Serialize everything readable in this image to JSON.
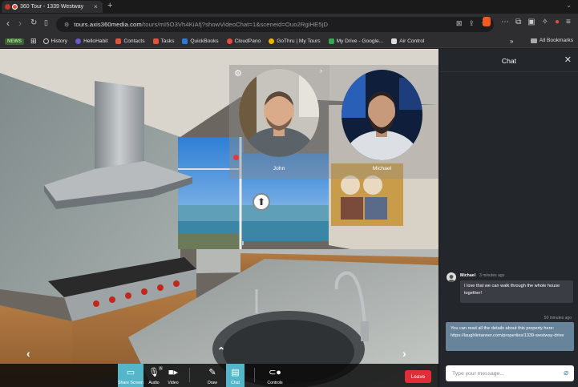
{
  "browser": {
    "tab_title": "360 Tour - 1339 Westway",
    "tab_close": "×",
    "new_tab": "+",
    "url_host": "tours.axis360media.com",
    "url_path": "/tours/mI5O3Vh4KiAfj?showVideoChat=1&sceneid=Ouo2RgiHE5jD",
    "brave_badge": "4"
  },
  "bookmarks": {
    "news_label": "NEWS",
    "items": [
      {
        "label": "History",
        "color": "#cfcfcf"
      },
      {
        "label": "HelloHabit",
        "color": "#6a5acd"
      },
      {
        "label": "Contacts",
        "color": "#e0533f"
      },
      {
        "label": "Tasks",
        "color": "#e0533f"
      },
      {
        "label": "QuickBooks",
        "color": "#2e7bd6"
      },
      {
        "label": "CloudPano",
        "color": "#e74c3c"
      },
      {
        "label": "GoThru | My Tours",
        "color": "#f0b400"
      },
      {
        "label": "My Drive - Google...",
        "color": "#34a853"
      },
      {
        "label": "Air Control",
        "color": "#dddddd"
      }
    ],
    "overflow": "»",
    "all_bookmarks": "All Bookmarks"
  },
  "video_chat": {
    "participants": [
      {
        "name": "John"
      },
      {
        "name": "Michael"
      }
    ]
  },
  "toolbar": {
    "share_screen": "Share Screen",
    "audio": "Audio",
    "video": "Video",
    "draw": "Draw",
    "chat": "Chat",
    "controls": "Controls",
    "leave": "Leave",
    "audio_badge": "A"
  },
  "chat": {
    "title": "Chat",
    "close": "✕",
    "messages": [
      {
        "sender": "Michael",
        "time": "3 minutes ago",
        "text": "I love that we can walk through the whole house together!"
      },
      {
        "sender": "",
        "time": "50 minutes ago",
        "text": "You can read all the details about this property here: https://laughlintanner.com/properties/1339-westway-drive"
      }
    ],
    "input_placeholder": "Type your message..."
  },
  "colors": {
    "accent": "#54b7c9",
    "leave": "#e12d39",
    "outgoing_bubble": "#67849b"
  }
}
